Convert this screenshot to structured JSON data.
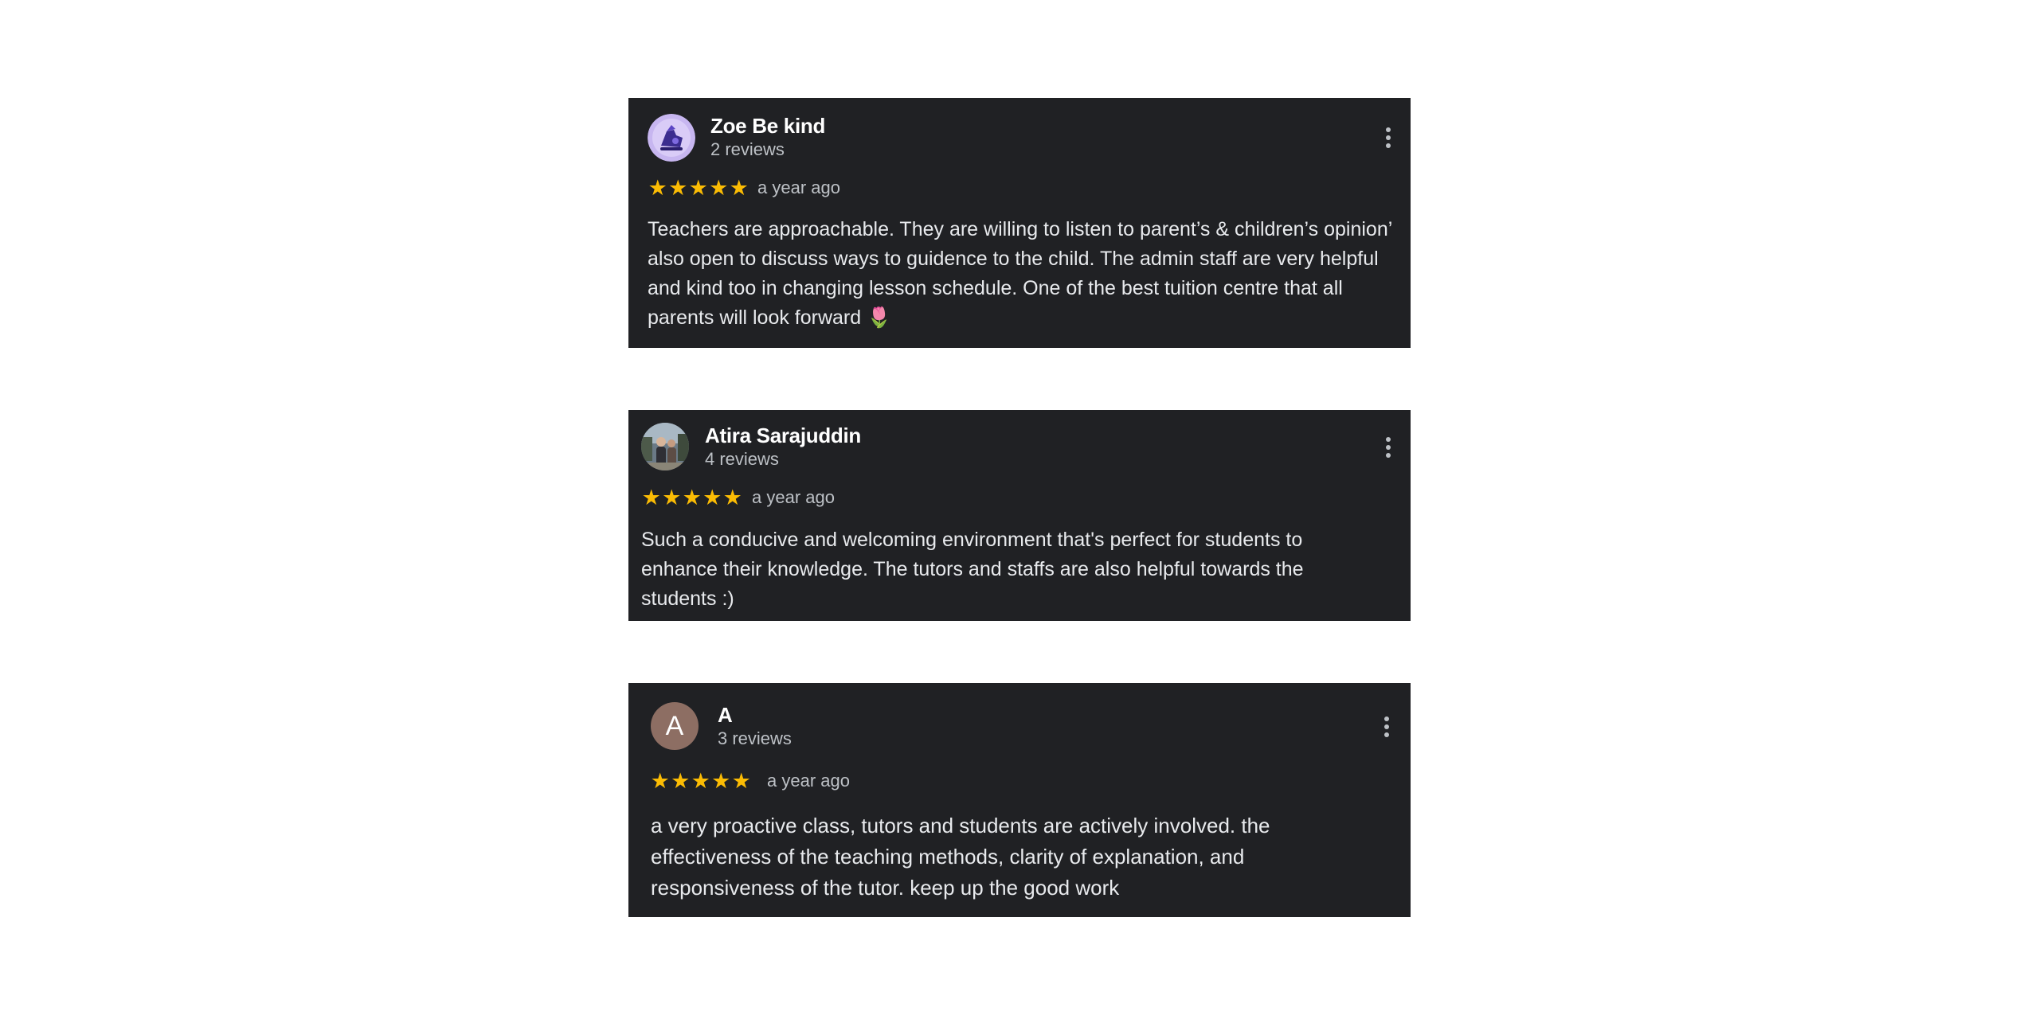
{
  "reviews": [
    {
      "author": "Zoe Be kind",
      "review_count": "2 reviews",
      "rating": 5,
      "date": "a year ago",
      "text": "Teachers are approachable. They are willing to listen to parent’s & children’s opinion’ also open to discuss ways to guidence to the child. The admin staff are very helpful and kind too in changing lesson schedule. One of the best tuition centre that all parents will look forward 🌷",
      "avatar_icon": "purple-illustration-avatar"
    },
    {
      "author": "Atira Sarajuddin",
      "review_count": "4 reviews",
      "rating": 5,
      "date": "a year ago",
      "text": "Such a conducive and welcoming environment that's perfect for students to enhance their knowledge. The tutors and staffs are also helpful towards the students :)",
      "avatar_icon": "photo-avatar"
    },
    {
      "author": "A",
      "avatar_letter": "A",
      "review_count": "3 reviews",
      "rating": 5,
      "date": "a year ago",
      "text": "a very proactive class, tutors and students are actively involved. the effectiveness of the teaching methods, clarity of explanation, and responsiveness of the tutor. keep up the good work",
      "avatar_icon": "letter-avatar"
    }
  ],
  "colors": {
    "card_background": "#202124",
    "star": "#fbbc04",
    "secondary_text": "#bdc1c6",
    "letter_avatar": "#8d6e63"
  }
}
